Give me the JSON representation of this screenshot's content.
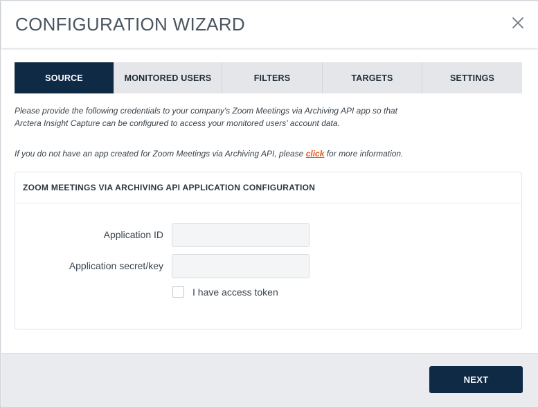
{
  "dialog": {
    "title": "CONFIGURATION WIZARD",
    "close_icon": "close-icon"
  },
  "tabs": [
    {
      "label": "SOURCE",
      "active": true
    },
    {
      "label": "MONITORED USERS",
      "active": false
    },
    {
      "label": "FILTERS",
      "active": false
    },
    {
      "label": "TARGETS",
      "active": false
    },
    {
      "label": "SETTINGS",
      "active": false
    }
  ],
  "intro": {
    "line1": "Please provide the following credentials to your company's Zoom Meetings via Archiving API app so that",
    "line2": "Arctera Insight Capture can be configured to access your monitored users' account data.",
    "help_prefix": "If you do not have an app created for Zoom Meetings via Archiving API, please ",
    "help_link": "click",
    "help_suffix": " for more information."
  },
  "panel": {
    "heading": "ZOOM MEETINGS VIA ARCHIVING API APPLICATION CONFIGURATION",
    "fields": {
      "app_id_label": "Application ID",
      "app_id_value": "",
      "app_id_placeholder": "",
      "secret_label": "Application secret/key",
      "secret_value": "",
      "secret_placeholder": ""
    },
    "checkbox": {
      "label": "I have access token",
      "checked": false
    }
  },
  "footer": {
    "next_label": "NEXT"
  },
  "colors": {
    "primary": "#0f2a45",
    "tab_inactive": "#e4e6e9",
    "link": "#e0581f",
    "footer_bg": "#e9ebee"
  }
}
